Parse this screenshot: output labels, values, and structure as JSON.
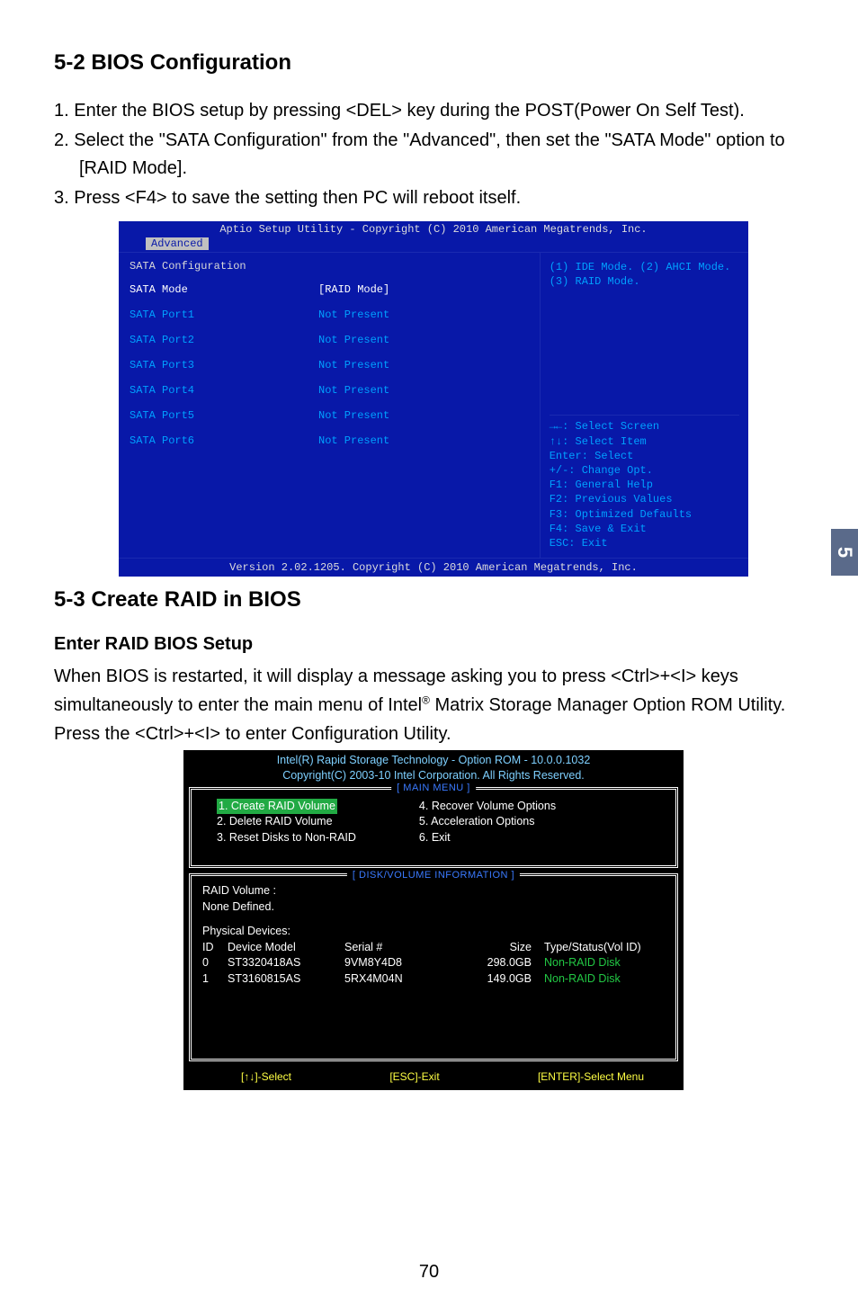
{
  "sideTab": "5",
  "h1": "5-2 BIOS Configuration",
  "intro": {
    "li1": "1. Enter the BIOS setup by pressing <DEL> key during the POST(Power On Self Test).",
    "li2": "2. Select the \"SATA Configuration\" from the \"Advanced\", then set the \"SATA Mode\"  option to [RAID Mode].",
    "li3": "3. Press <F4> to save the setting then PC will reboot itself."
  },
  "bios": {
    "header": "Aptio Setup Utility - Copyright (C) 2010 American Megatrends, Inc.",
    "tab": "Advanced",
    "sataTitle": "SATA Configuration",
    "rows": [
      {
        "k": "SATA Mode",
        "v": "[RAID Mode]"
      },
      {
        "k": "SATA Port1",
        "v": "Not Present"
      },
      {
        "k": "SATA Port2",
        "v": "Not Present"
      },
      {
        "k": "SATA Port3",
        "v": "Not Present"
      },
      {
        "k": "SATA Port4",
        "v": "Not Present"
      },
      {
        "k": "SATA Port5",
        "v": "Not Present"
      },
      {
        "k": "SATA Port6",
        "v": "Not Present"
      }
    ],
    "hintTop": "(1) IDE Mode. (2) AHCI Mode.\n(3) RAID Mode.",
    "hintBot": "→←: Select Screen\n↑↓: Select Item\nEnter: Select\n+/-: Change Opt.\nF1: General Help\nF2: Previous Values\nF3: Optimized Defaults\nF4: Save & Exit\nESC: Exit",
    "footer": "Version 2.02.1205. Copyright (C) 2010 American Megatrends, Inc."
  },
  "h2": "5-3 Create RAID in BIOS",
  "sub": "Enter  RAID BIOS Setup",
  "para": {
    "p1a": "When BIOS is restarted, it will display a message asking you to press <Ctrl>+<I> keys simultaneously to enter the main menu of Intel",
    "sup": "®",
    "p1b": " Matrix Storage Manager Option ROM Utility. Press the <Ctrl>+<I> to enter Configuration Utility."
  },
  "raid": {
    "hdr1": "Intel(R) Rapid Storage Technology - Option ROM - 10.0.0.1032",
    "hdr2": "Copyright(C) 2003-10 Intel Corporation.   All Rights Reserved.",
    "mainTitle": "[ MAIN MENU ]",
    "menuLeft": {
      "m1": "1. Create RAID Volume",
      "m2": "2. Delete RAID Volume",
      "m3": "3. Reset Disks to Non-RAID"
    },
    "menuRight": {
      "m4": "4. Recover Volume Options",
      "m5": "5. Acceleration Options",
      "m6": "6. Exit"
    },
    "infoTitle": "[ DISK/VOLUME INFORMATION ]",
    "vol1": "RAID Volume :",
    "vol2": "None Defined.",
    "phys": "Physical Devices:",
    "cols": {
      "c1": "ID",
      "c2": "Device Model",
      "c3": "Serial #",
      "c4": "Size",
      "c5": "Type/Status(Vol ID)"
    },
    "rows": [
      {
        "id": "0",
        "model": "ST3320418AS",
        "serial": "9VM8Y4D8",
        "size": "298.0GB",
        "type": "Non-RAID Disk"
      },
      {
        "id": "1",
        "model": "ST3160815AS",
        "serial": "5RX4M04N",
        "size": "149.0GB",
        "type": "Non-RAID Disk"
      }
    ],
    "foot": {
      "f1": "[↑↓]-Select",
      "f2": "[ESC]-Exit",
      "f3": "[ENTER]-Select Menu"
    }
  },
  "pageNum": "70"
}
